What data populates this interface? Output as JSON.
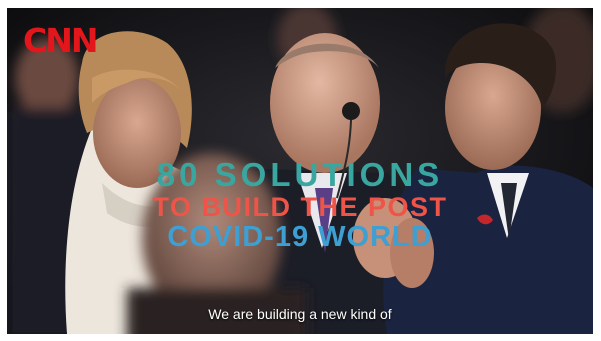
{
  "logo": {
    "text": "CNN",
    "color": "#e3171b"
  },
  "headline": {
    "line1": "80 SOLUTIONS",
    "line2": "TO BUILD THE POST",
    "line3": "COVID-19 WORLD",
    "colors": {
      "line1": "#3aa6a0",
      "line2": "#ef5448",
      "line3": "#3d9fd2"
    }
  },
  "caption": {
    "text": "We are building a new kind of"
  },
  "colors": {
    "background": "#0b0b0d"
  }
}
